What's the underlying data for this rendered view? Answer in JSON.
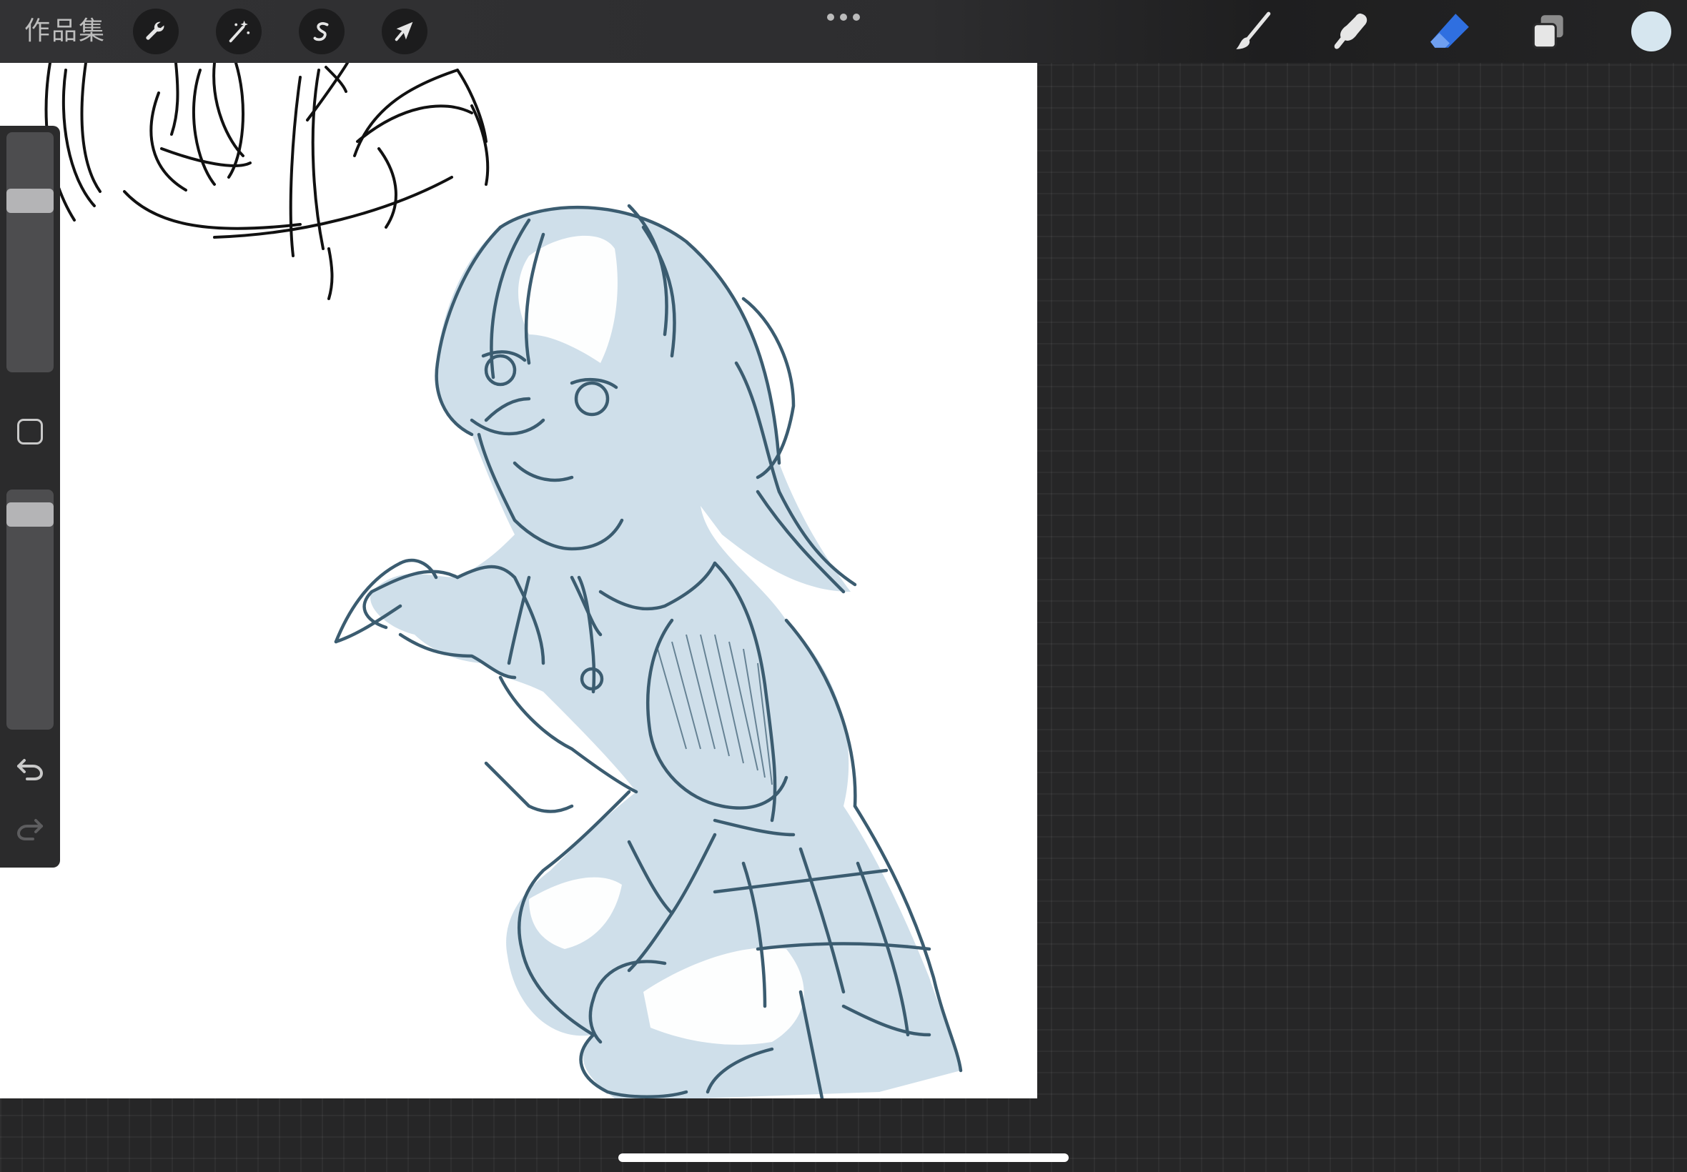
{
  "topbar": {
    "gallery_label": "作品集",
    "left_tools": [
      {
        "name": "actions",
        "icon": "wrench-icon"
      },
      {
        "name": "adjustments",
        "icon": "magic-wand-icon"
      },
      {
        "name": "selection",
        "icon": "selection-s-icon"
      },
      {
        "name": "transform",
        "icon": "arrow-cursor-icon"
      }
    ],
    "center_menu_icon": "ellipsis-icon",
    "right_tools": [
      {
        "name": "brush",
        "icon": "brush-icon",
        "active": false
      },
      {
        "name": "smudge",
        "icon": "smudge-finger-icon",
        "active": false
      },
      {
        "name": "eraser",
        "icon": "eraser-icon",
        "active": true
      },
      {
        "name": "layers",
        "icon": "layers-icon",
        "active": false
      }
    ],
    "current_color": "#d6e6ef"
  },
  "sidebar": {
    "brush_size_level": 0.74,
    "opacity_level": 0.94,
    "undo_icon": "undo-icon",
    "redo_icon": "redo-icon",
    "redo_enabled": false
  },
  "colors": {
    "accent": "#2f6fe0",
    "sketch_line": "#3b5c70",
    "sketch_fill": "#cfdfea",
    "canvas": "#ffffff",
    "workspace": "#262627"
  }
}
